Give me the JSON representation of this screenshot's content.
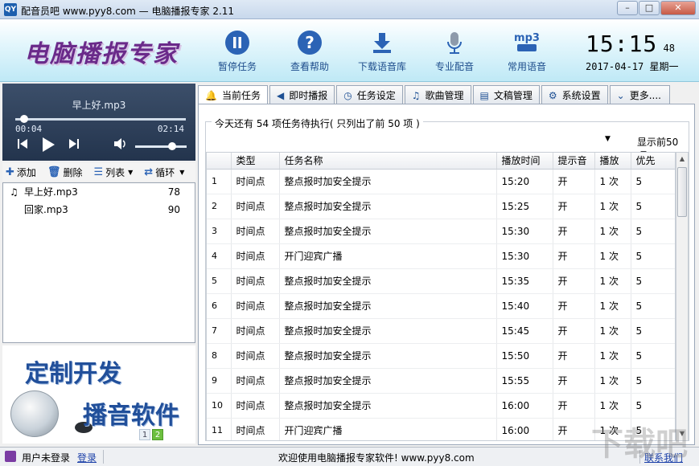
{
  "window": {
    "title": "配音员吧 www.pyy8.com — 电脑播报专家 2.11",
    "app_icon": "QY"
  },
  "header": {
    "logo": "电脑播报专家",
    "toolbar": [
      {
        "label": "暂停任务",
        "icon": "pause-icon"
      },
      {
        "label": "查看帮助",
        "icon": "help-icon"
      },
      {
        "label": "下载语音库",
        "icon": "download-icon"
      },
      {
        "label": "专业配音",
        "icon": "microphone-icon"
      },
      {
        "label": "常用语音",
        "icon": "mp3-icon",
        "icon_text": "mp3"
      }
    ],
    "clock": {
      "time": "15:15",
      "seconds": "48",
      "date": "2017-04-17 星期一"
    }
  },
  "player": {
    "song": "早上好.mp3",
    "current": "00:04",
    "total": "02:14",
    "progress_fraction": 0.03,
    "volume_fraction": 0.75
  },
  "list_tools": {
    "add": "添加",
    "delete": "删除",
    "list": "列表",
    "loop": "循环"
  },
  "playlist": [
    {
      "name": "早上好.mp3",
      "count": "78",
      "playing": true
    },
    {
      "name": "回家.mp3",
      "count": "90",
      "playing": false
    }
  ],
  "promo": {
    "line1": "定制开发",
    "line2": "播音软件",
    "pages": [
      "1",
      "2"
    ],
    "active_page": "2"
  },
  "tabs": [
    {
      "label": "当前任务",
      "icon": "bell-icon",
      "active": true
    },
    {
      "label": "即时播报",
      "icon": "speaker-icon",
      "active": false
    },
    {
      "label": "任务设定",
      "icon": "clock-icon",
      "active": false
    },
    {
      "label": "歌曲管理",
      "icon": "music-icon",
      "active": false
    },
    {
      "label": "文稿管理",
      "icon": "document-icon",
      "active": false
    },
    {
      "label": "系统设置",
      "icon": "gear-icon",
      "active": false
    },
    {
      "label": "更多....",
      "icon": "chevron-down-icon",
      "active": false
    }
  ],
  "tasks": {
    "summary": "今天还有 54 项任务待执行( 只列出了前 50 项 )",
    "filter": "显示前50项",
    "columns": [
      "",
      "类型",
      "任务名称",
      "播放时间",
      "提示音",
      "播放",
      "优先"
    ],
    "rows": [
      [
        "1",
        "时间点",
        "整点报时加安全提示",
        "15:20",
        "开",
        "1 次",
        "5"
      ],
      [
        "2",
        "时间点",
        "整点报时加安全提示",
        "15:25",
        "开",
        "1 次",
        "5"
      ],
      [
        "3",
        "时间点",
        "整点报时加安全提示",
        "15:30",
        "开",
        "1 次",
        "5"
      ],
      [
        "4",
        "时间点",
        "开门迎宾广播",
        "15:30",
        "开",
        "1 次",
        "5"
      ],
      [
        "5",
        "时间点",
        "整点报时加安全提示",
        "15:35",
        "开",
        "1 次",
        "5"
      ],
      [
        "6",
        "时间点",
        "整点报时加安全提示",
        "15:40",
        "开",
        "1 次",
        "5"
      ],
      [
        "7",
        "时间点",
        "整点报时加安全提示",
        "15:45",
        "开",
        "1 次",
        "5"
      ],
      [
        "8",
        "时间点",
        "整点报时加安全提示",
        "15:50",
        "开",
        "1 次",
        "5"
      ],
      [
        "9",
        "时间点",
        "整点报时加安全提示",
        "15:55",
        "开",
        "1 次",
        "5"
      ],
      [
        "10",
        "时间点",
        "整点报时加安全提示",
        "16:00",
        "开",
        "1 次",
        "5"
      ],
      [
        "11",
        "时间点",
        "开门迎宾广播",
        "16:00",
        "开",
        "1 次",
        "5"
      ]
    ]
  },
  "status": {
    "user": "用户未登录",
    "login": "登录",
    "welcome": "欢迎使用电脑播报专家软件! www.pyy8.com",
    "contact": "联系我们"
  },
  "watermark": "下载吧"
}
